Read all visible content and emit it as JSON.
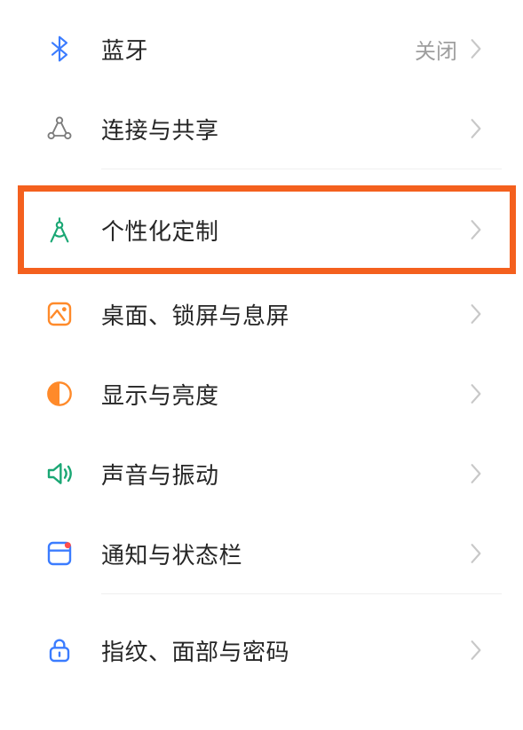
{
  "rows": [
    {
      "id": "bluetooth",
      "label": "蓝牙",
      "value": "关闭",
      "highlighted": false
    },
    {
      "id": "connect-share",
      "label": "连接与共享",
      "value": "",
      "highlighted": false
    },
    {
      "id": "personalization",
      "label": "个性化定制",
      "value": "",
      "highlighted": true
    },
    {
      "id": "desktop-lock",
      "label": "桌面、锁屏与息屏",
      "value": "",
      "highlighted": false
    },
    {
      "id": "display",
      "label": "显示与亮度",
      "value": "",
      "highlighted": false
    },
    {
      "id": "sound",
      "label": "声音与振动",
      "value": "",
      "highlighted": false
    },
    {
      "id": "notifications",
      "label": "通知与状态栏",
      "value": "",
      "highlighted": false
    },
    {
      "id": "biometrics",
      "label": "指纹、面部与密码",
      "value": "",
      "highlighted": false
    }
  ]
}
